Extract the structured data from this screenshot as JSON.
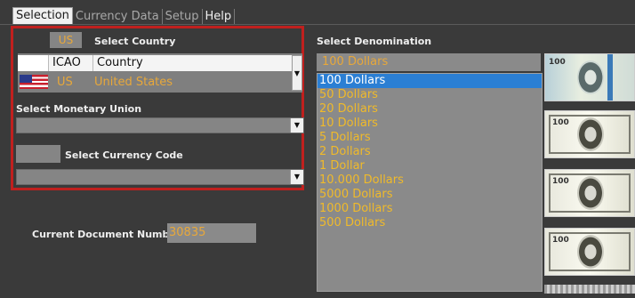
{
  "menu": [
    "Selection",
    "Currency Data",
    "Setup",
    "Help"
  ],
  "country": {
    "code": "US",
    "label": "Select Country",
    "columns": [
      "ICAO",
      "Country"
    ],
    "selected_row": {
      "icao": "US",
      "country": "United States"
    }
  },
  "monetary_union": {
    "label": "Select Monetary Union",
    "value": ""
  },
  "currency_code": {
    "label": "Select Currency Code",
    "code": "",
    "value": ""
  },
  "document": {
    "label": "Current Document Number",
    "value": "30835"
  },
  "denomination": {
    "label": "Select Denomination",
    "current": "100 Dollars",
    "items": [
      "100 Dollars",
      "50 Dollars",
      "20 Dollars",
      "10 Dollars",
      "5 Dollars",
      "2 Dollars",
      "1 Dollar",
      "10.000 Dollars",
      "5000 Dollars",
      "1000 Dollars",
      "500 Dollars"
    ],
    "selected_index": 0
  },
  "bill_images": [
    "100-dollar-bill-new",
    "100-dollar-bill-old-1",
    "100-dollar-bill-old-2",
    "100-dollar-bill-old-3"
  ],
  "colors": {
    "accent": "#e8a83a",
    "highlight_box": "#c0201e",
    "selection": "#2b7fd4"
  }
}
